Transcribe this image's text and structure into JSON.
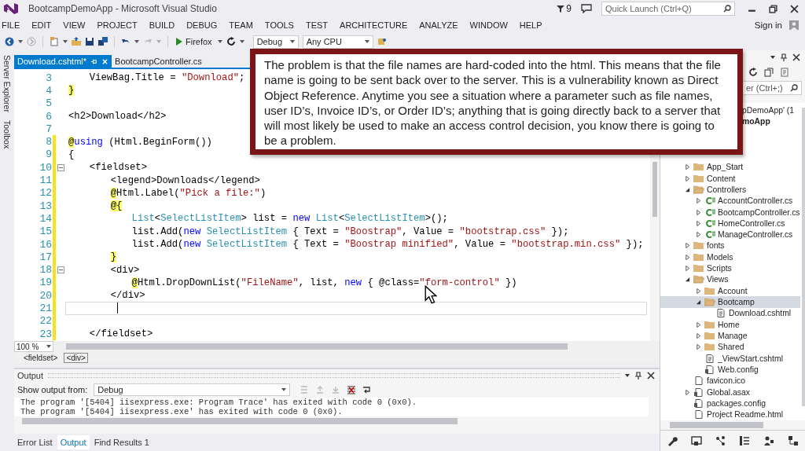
{
  "window": {
    "title": "BootcampDemoApp - Microsoft Visual Studio",
    "notification_count": "9",
    "quick_launch": {
      "placeholder": "Quick Launch (Ctrl+Q)"
    }
  },
  "menu": [
    "FILE",
    "EDIT",
    "VIEW",
    "PROJECT",
    "BUILD",
    "DEBUG",
    "TEAM",
    "TOOLS",
    "TEST",
    "ARCHITECTURE",
    "ANALYZE",
    "WINDOW",
    "HELP"
  ],
  "sign_in": "Sign in",
  "toolbar": {
    "start_target": "Firefox",
    "configuration": "Debug",
    "platform": "Any CPU"
  },
  "side_tabs": [
    "Server Explorer",
    "Toolbox"
  ],
  "editor": {
    "tabs": [
      {
        "label": "Download.cshtml*",
        "selected": true
      },
      {
        "label": "BootcampController.cs",
        "selected": false
      }
    ],
    "lines": [
      {
        "number": "3",
        "changed": false,
        "segments": [
          {
            "kind": "plain",
            "t": "    ViewBag.Title = "
          },
          {
            "kind": "string",
            "t": "\"Download\""
          },
          {
            "kind": "plain",
            "t": ";"
          }
        ]
      },
      {
        "number": "4",
        "changed": false,
        "segments": [
          {
            "kind": "razor",
            "t": "}"
          }
        ]
      },
      {
        "number": "5",
        "changed": false
      },
      {
        "number": "6",
        "changed": false,
        "segments": [
          {
            "kind": "plain",
            "t": "<h2>Download</h2>"
          }
        ]
      },
      {
        "number": "7",
        "changed": false
      },
      {
        "number": "8",
        "changed": true,
        "segments": [
          {
            "kind": "razor",
            "t": "@"
          },
          {
            "kind": "keyword",
            "t": "using"
          },
          {
            "kind": "plain",
            "t": " (Html.BeginForm())"
          }
        ]
      },
      {
        "number": "9",
        "changed": true,
        "segments": [
          {
            "kind": "plain",
            "t": "{"
          }
        ]
      },
      {
        "number": "10",
        "changed": true,
        "fold": true,
        "segments": [
          {
            "kind": "plain",
            "t": "    <fieldset>"
          }
        ]
      },
      {
        "number": "11",
        "changed": true,
        "segments": [
          {
            "kind": "plain",
            "t": "        <legend>Downloads</legend>"
          }
        ]
      },
      {
        "number": "12",
        "changed": true,
        "segments": [
          {
            "kind": "razor",
            "t": "        @"
          },
          {
            "kind": "plain",
            "t": "Html.Label("
          },
          {
            "kind": "string",
            "t": "\"Pick a file:\""
          },
          {
            "kind": "plain",
            "t": ")"
          }
        ]
      },
      {
        "number": "13",
        "changed": true,
        "segments": [
          {
            "kind": "razor",
            "t": "        @{"
          }
        ]
      },
      {
        "number": "14",
        "changed": true,
        "segments": [
          {
            "kind": "type",
            "t": "            List"
          },
          {
            "kind": "plain",
            "t": "<"
          },
          {
            "kind": "type",
            "t": "SelectListItem"
          },
          {
            "kind": "plain",
            "t": "> list = "
          },
          {
            "kind": "keyword",
            "t": "new"
          },
          {
            "kind": "type",
            "t": " List"
          },
          {
            "kind": "plain",
            "t": "<"
          },
          {
            "kind": "type",
            "t": "SelectListItem"
          },
          {
            "kind": "plain",
            "t": ">();"
          }
        ]
      },
      {
        "number": "15",
        "changed": true,
        "segments": [
          {
            "kind": "plain",
            "t": "            list.Add("
          },
          {
            "kind": "keyword",
            "t": "new"
          },
          {
            "kind": "type",
            "t": " SelectListItem"
          },
          {
            "kind": "plain",
            "t": " { Text = "
          },
          {
            "kind": "string",
            "t": "\"Boostrap\""
          },
          {
            "kind": "plain",
            "t": ", Value = "
          },
          {
            "kind": "string",
            "t": "\"bootstrap.css\""
          },
          {
            "kind": "plain",
            "t": " });"
          }
        ]
      },
      {
        "number": "16",
        "changed": true,
        "segments": [
          {
            "kind": "plain",
            "t": "            list.Add("
          },
          {
            "kind": "keyword",
            "t": "new"
          },
          {
            "kind": "type",
            "t": " SelectListItem"
          },
          {
            "kind": "plain",
            "t": " { Text = "
          },
          {
            "kind": "string",
            "t": "\"Boostrap minified\""
          },
          {
            "kind": "plain",
            "t": ", Value = "
          },
          {
            "kind": "string",
            "t": "\"bootstrap.min.css\""
          },
          {
            "kind": "plain",
            "t": " });"
          }
        ]
      },
      {
        "number": "17",
        "changed": true,
        "segments": [
          {
            "kind": "razor",
            "t": "        }"
          }
        ]
      },
      {
        "number": "18",
        "changed": true,
        "fold": true,
        "segments": [
          {
            "kind": "plain",
            "t": "        <div>"
          }
        ]
      },
      {
        "number": "19",
        "changed": true,
        "segments": [
          {
            "kind": "razor",
            "t": "            @"
          },
          {
            "kind": "plain",
            "t": "Html.DropDownList("
          },
          {
            "kind": "string",
            "t": "\"FileName\""
          },
          {
            "kind": "plain",
            "t": ", list, "
          },
          {
            "kind": "keyword",
            "t": "new"
          },
          {
            "kind": "plain",
            "t": " { @class="
          },
          {
            "kind": "string",
            "t": "\"form-control\""
          },
          {
            "kind": "plain",
            "t": " })"
          }
        ]
      },
      {
        "number": "20",
        "changed": true,
        "segments": [
          {
            "kind": "plain",
            "t": "        </div>"
          }
        ]
      },
      {
        "number": "21",
        "changed": true,
        "current": true
      },
      {
        "number": "22",
        "changed": true
      },
      {
        "number": "23",
        "changed": true,
        "segments": [
          {
            "kind": "plain",
            "t": "    </fieldset>"
          }
        ]
      }
    ],
    "zoom": "100 %",
    "breadcrumb": [
      {
        "label": "<fieldset>",
        "selected": false
      },
      {
        "label": "<div>",
        "selected": true
      }
    ]
  },
  "callout": {
    "text": "The problem is that the file names are hard-coded into the html. This means that the file name is going to be sent back over to the server. This is a vulnerability known as Direct Object Reference. Anytime you see a situation where a parameter such as file names, user ID’s, Invoice ID’s, or Order ID’s; anything that is going directly back to a server that will most likely be used to make an access control decision, you know there is going to be a problem."
  },
  "output": {
    "title": "Output",
    "show_from_label": "Show output from:",
    "source": "Debug",
    "lines": [
      "The program '[5404] iisexpress.exe: Program Trace' has exited with code 0 (0x0).",
      "The program '[5404] iisexpress.exe' has exited with code 0 (0x0)."
    ]
  },
  "bottom_tabs": [
    {
      "label": "Error List",
      "selected": false
    },
    {
      "label": "Output",
      "selected": true
    },
    {
      "label": "Find Results 1",
      "selected": false
    }
  ],
  "solution_explorer": {
    "search": {
      "placeholder": "er (Ctrl+;)"
    },
    "tree": [
      {
        "label": "pDemoApp' (1",
        "kind": "solution",
        "selected": false,
        "children": [
          {
            "label": "moApp",
            "kind": "project",
            "selected": false,
            "children": [
              {
                "label": "App_Start",
                "kind": "folder",
                "expanded": false,
                "selected": false
              },
              {
                "label": "Content",
                "kind": "folder",
                "expanded": false,
                "selected": false
              },
              {
                "label": "Controllers",
                "kind": "folder",
                "expanded": true,
                "selected": false,
                "children": [
                  {
                    "label": "AccountController.cs",
                    "kind": "cs",
                    "expanded": false,
                    "selected": false
                  },
                  {
                    "label": "BootcampController.cs",
                    "kind": "cs",
                    "expanded": false,
                    "selected": false
                  },
                  {
                    "label": "HomeController.cs",
                    "kind": "cs",
                    "expanded": false,
                    "selected": false
                  },
                  {
                    "label": "ManageController.cs",
                    "kind": "cs",
                    "expanded": false,
                    "selected": false
                  }
                ]
              },
              {
                "label": "fonts",
                "kind": "folder",
                "expanded": false,
                "selected": false
              },
              {
                "label": "Models",
                "kind": "folder",
                "expanded": false,
                "selected": false
              },
              {
                "label": "Scripts",
                "kind": "folder",
                "expanded": false,
                "selected": false
              },
              {
                "label": "Views",
                "kind": "folder",
                "expanded": true,
                "selected": false,
                "children": [
                  {
                    "label": "Account",
                    "kind": "folder",
                    "expanded": false,
                    "selected": false
                  },
                  {
                    "label": "Bootcamp",
                    "kind": "folder",
                    "expanded": true,
                    "selected": true,
                    "children": [
                      {
                        "label": "Download.cshtml",
                        "kind": "cshtml",
                        "selected": false
                      }
                    ]
                  },
                  {
                    "label": "Home",
                    "kind": "folder",
                    "expanded": false,
                    "selected": false
                  },
                  {
                    "label": "Manage",
                    "kind": "folder",
                    "expanded": false,
                    "selected": false
                  },
                  {
                    "label": "Shared",
                    "kind": "folder",
                    "expanded": false,
                    "selected": false
                  },
                  {
                    "label": "_ViewStart.cshtml",
                    "kind": "cshtml",
                    "selected": false
                  },
                  {
                    "label": "Web.config",
                    "kind": "config",
                    "selected": false
                  }
                ]
              },
              {
                "label": "favicon.ico",
                "kind": "file",
                "selected": false
              },
              {
                "label": "Global.asax",
                "kind": "asax",
                "expanded": false,
                "selected": false
              },
              {
                "label": "packages.config",
                "kind": "config",
                "selected": false
              },
              {
                "label": "Project Readme.html",
                "kind": "file",
                "selected": false
              }
            ]
          }
        ]
      }
    ]
  }
}
